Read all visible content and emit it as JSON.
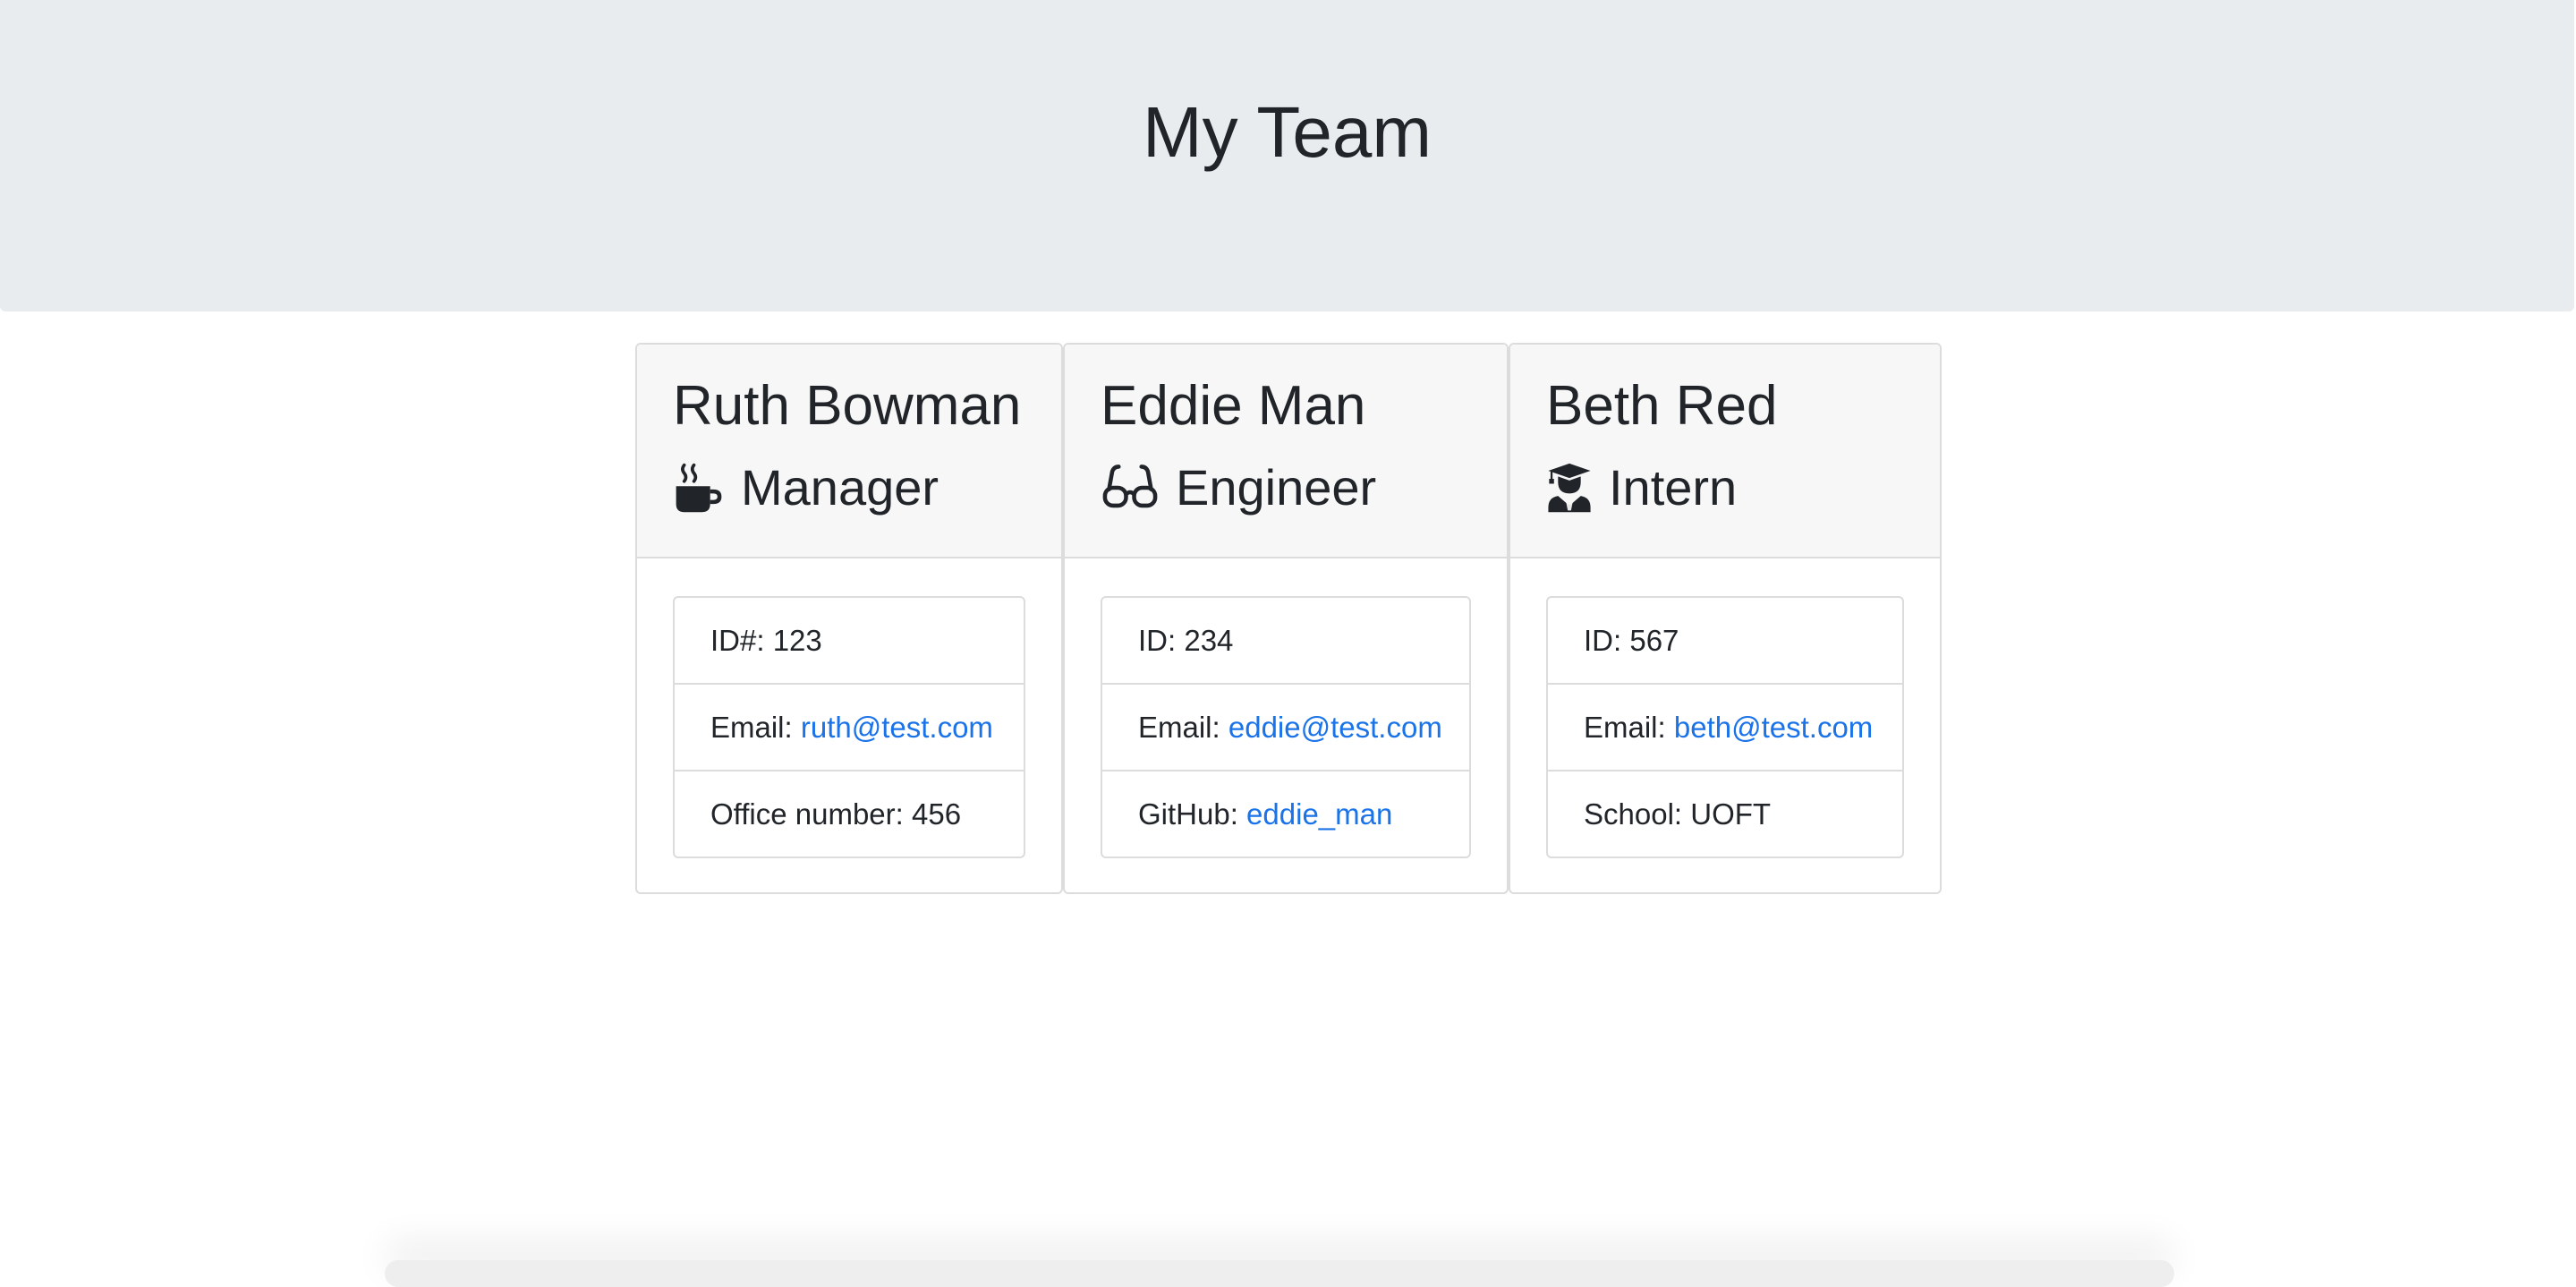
{
  "header": {
    "title": "My Team"
  },
  "cards": [
    {
      "name": "Ruth Bowman",
      "role": "Manager",
      "icon": "mug-hot-icon",
      "items": [
        {
          "label": "ID#: ",
          "value": "123"
        },
        {
          "label": "Email: ",
          "value": "ruth@test.com"
        },
        {
          "label": "Office number: ",
          "value": "456"
        }
      ]
    },
    {
      "name": "Eddie Man",
      "role": "Engineer",
      "icon": "glasses-icon",
      "items": [
        {
          "label": "ID: ",
          "value": "234"
        },
        {
          "label": "Email: ",
          "value": "eddie@test.com"
        },
        {
          "label": "GitHub: ",
          "value": "eddie_man"
        }
      ]
    },
    {
      "name": "Beth Red",
      "role": "Intern",
      "icon": "user-graduate-icon",
      "items": [
        {
          "label": "ID: ",
          "value": "567"
        },
        {
          "label": "Email: ",
          "value": "beth@test.com"
        },
        {
          "label": "School: ",
          "value": "UOFT"
        }
      ]
    }
  ],
  "colors": {
    "link": "#1a73e8",
    "jumbotron": "#e9ecef",
    "card_header": "#f7f7f7"
  }
}
